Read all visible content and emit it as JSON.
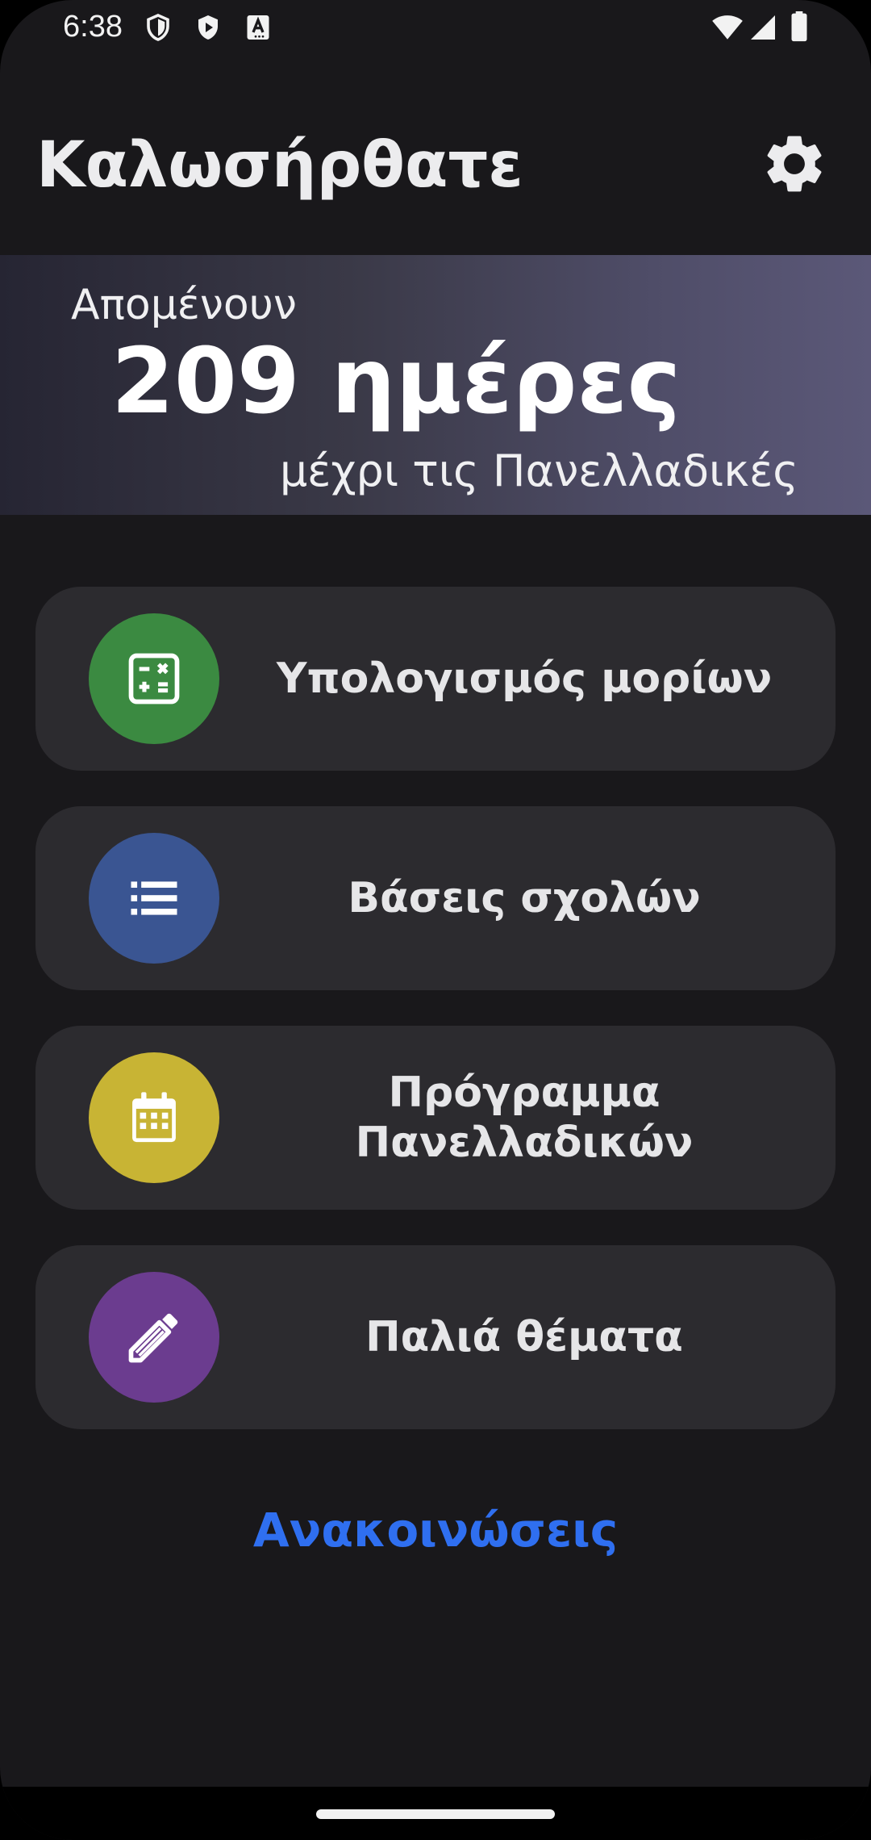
{
  "status_bar": {
    "time": "6:38",
    "icons": [
      "shield-icon",
      "play-store-icon",
      "font-a-icon",
      "wifi-icon",
      "signal-icon",
      "battery-icon"
    ]
  },
  "header": {
    "title": "Καλωσήρθατε",
    "settings_icon": "gear-icon"
  },
  "countdown": {
    "remaining_label": "Απομένουν",
    "days_text": "209 ημέρες",
    "until_label": "μέχρι τις Πανελλαδικές"
  },
  "menu": {
    "items": [
      {
        "label": "Υπολογισμός μορίων",
        "icon": "calculator-icon",
        "color": "#3b8a41"
      },
      {
        "label": "Βάσεις σχολών",
        "icon": "list-icon",
        "color": "#3a5592"
      },
      {
        "label": "Πρόγραμμα Πανελλαδικών",
        "icon": "calendar-icon",
        "color": "#c8b434"
      },
      {
        "label": "Παλιά θέματα",
        "icon": "pencil-icon",
        "color": "#6b3c8f"
      }
    ]
  },
  "footer": {
    "announcements_label": "Ανακοινώσεις",
    "accent_color": "#2f6ff0"
  }
}
